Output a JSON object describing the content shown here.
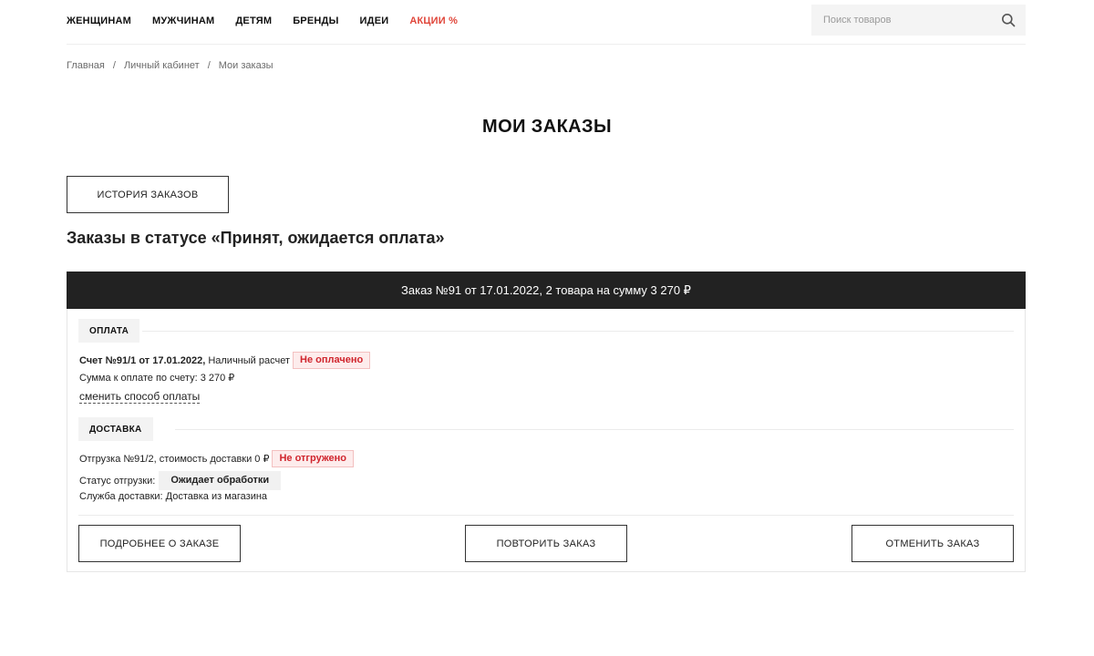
{
  "header": {
    "nav": [
      {
        "label": "ЖЕНЩИНАМ"
      },
      {
        "label": "МУЖЧИНАМ"
      },
      {
        "label": "ДЕТЯМ"
      },
      {
        "label": "БРЕНДЫ"
      },
      {
        "label": "ИДЕИ"
      },
      {
        "label": "АКЦИИ %"
      }
    ],
    "search_placeholder": "Поиск товаров"
  },
  "breadcrumb": [
    {
      "label": "Главная"
    },
    {
      "label": "Личный кабинет"
    },
    {
      "label": "Мои заказы"
    }
  ],
  "page_title": "МОИ ЗАКАЗЫ",
  "history_button": "ИСТОРИЯ ЗАКАЗОВ",
  "status_heading": "Заказы в статусе «Принят, ожидается оплата»",
  "order": {
    "title": "Заказ №91 от 17.01.2022, 2 товара на сумму 3 270 ₽",
    "payment": {
      "section_label": "ОПЛАТА",
      "invoice": "Счет №91/1 от 17.01.2022,",
      "method": "Наличный расчет",
      "status": "Не оплачено",
      "amount": "Сумма к оплате по счету: 3 270 ₽",
      "change_link": "сменить способ оплаты"
    },
    "delivery": {
      "section_label": "ДОСТАВКА",
      "shipment": "Отгрузка №91/2, стоимость доставки 0 ₽",
      "shipment_status_badge": "Не отгружено",
      "status_label": "Статус отгрузки:",
      "status_value": "Ожидает обработки",
      "service": "Служба доставки: Доставка из магазина"
    },
    "actions": {
      "details": "ПОДРОБНЕЕ О ЗАКАЗЕ",
      "repeat": "ПОВТОРИТЬ ЗАКАЗ",
      "cancel": "ОТМЕНИТЬ ЗАКАЗ"
    }
  },
  "colors": {
    "promo": "#e0463a",
    "order_header_bg": "#222222",
    "badge_red": "#d0252d",
    "badge_red_bg": "#fdecec"
  }
}
